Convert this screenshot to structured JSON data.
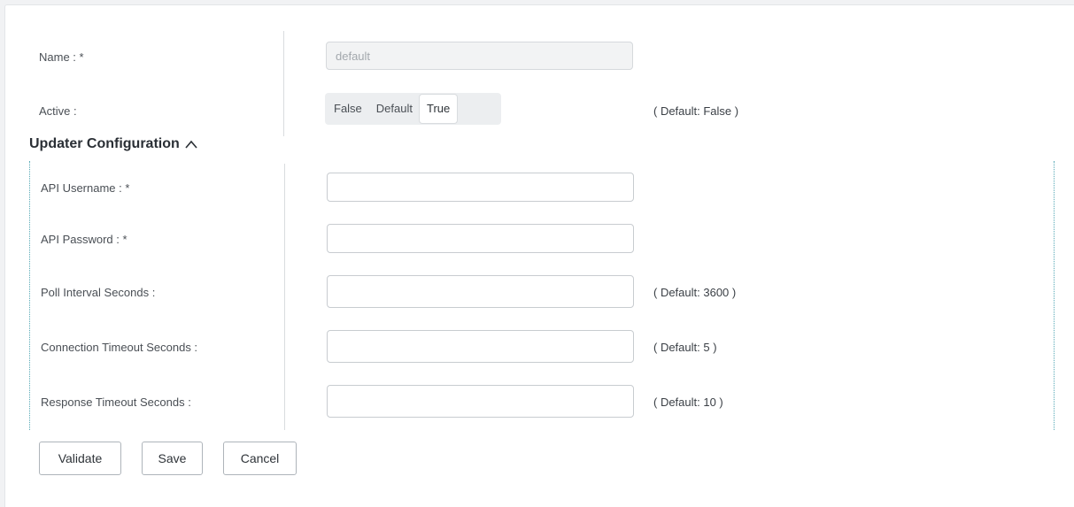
{
  "general": {
    "name_label": "Name : *",
    "name_value": "default",
    "active_label": "Active :",
    "active_options": [
      "False",
      "Default",
      "True"
    ],
    "active_selected": "True",
    "active_hint": "( Default: False )"
  },
  "updater": {
    "section_title": "Updater Configuration",
    "section_icon": "chevron-up-icon",
    "fields": [
      {
        "label": "API Username : *",
        "value": "",
        "hint": ""
      },
      {
        "label": "API Password : *",
        "value": "",
        "hint": ""
      },
      {
        "label": "Poll Interval Seconds :",
        "value": "",
        "hint": "( Default: 3600 )"
      },
      {
        "label": "Connection Timeout Seconds :",
        "value": "",
        "hint": "( Default: 5 )"
      },
      {
        "label": "Response Timeout Seconds :",
        "value": "",
        "hint": "( Default: 10 )"
      }
    ]
  },
  "actions": {
    "validate_label": "Validate",
    "save_label": "Save",
    "cancel_label": "Cancel"
  }
}
